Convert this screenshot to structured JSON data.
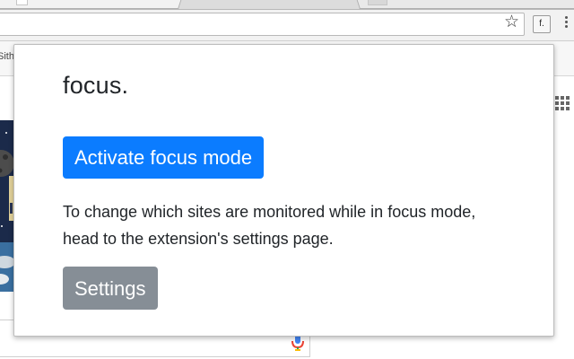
{
  "browser": {
    "extension_icon_label": "f.",
    "bookmark_fragment": "Sith",
    "icons": {
      "star": "star-icon",
      "extension": "focus-extension-icon",
      "menu": "menu-icon",
      "apps": "apps-icon",
      "mic": "mic-icon"
    }
  },
  "popup": {
    "title": "focus.",
    "activate_label": "Activate focus mode",
    "description": "To change which sites are monitored while in focus mode, head to the extension's settings page.",
    "settings_label": "Settings"
  },
  "colors": {
    "primary_button": "#0b7cff",
    "secondary_button": "#868e96",
    "text": "#212529"
  }
}
